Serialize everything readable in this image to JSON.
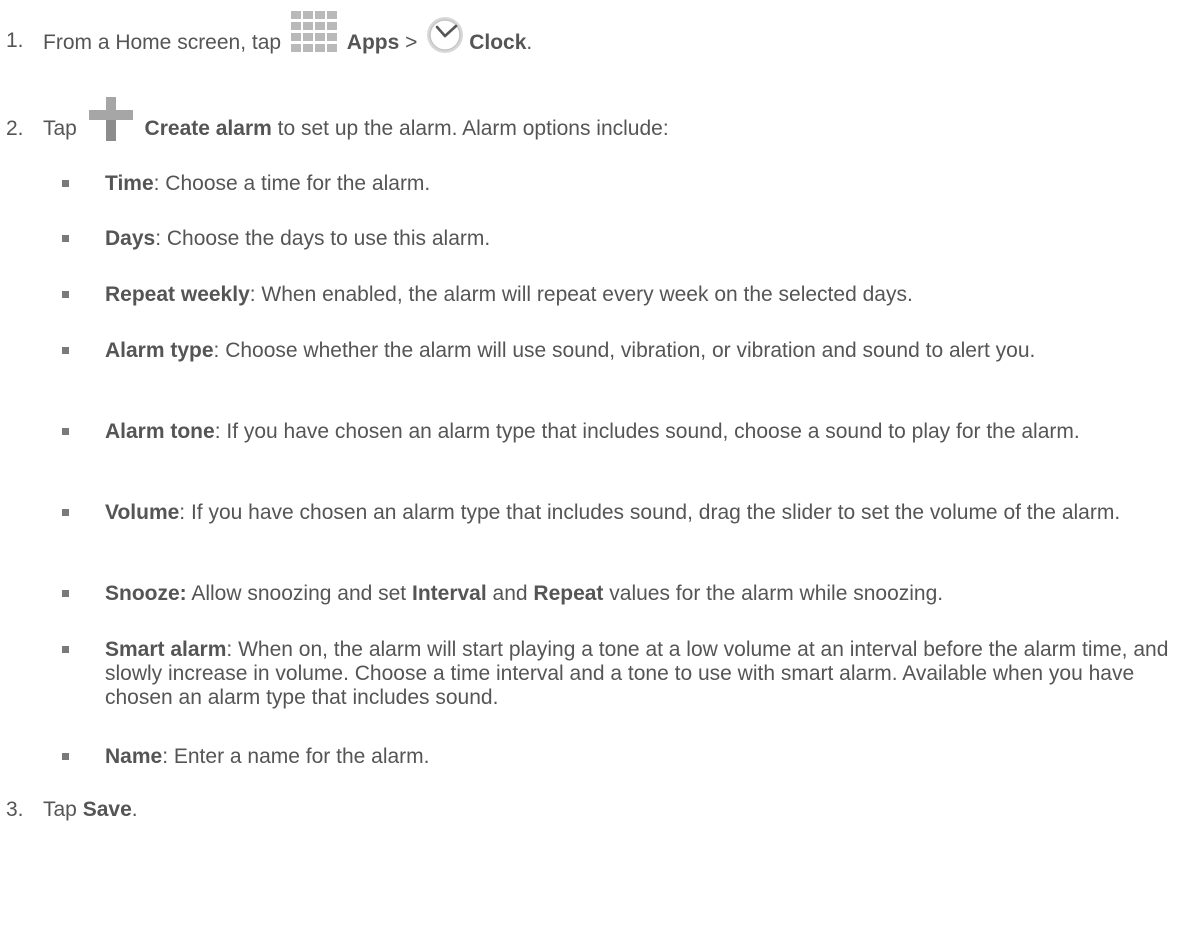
{
  "step1": {
    "num": "1.",
    "pre": "From a Home screen, tap",
    "apps": "Apps",
    "sep": ">",
    "clock": "Clock",
    "end": "."
  },
  "step2": {
    "num": "2.",
    "pre": "Tap",
    "create": "Create alarm",
    "post": "to set up the alarm. Alarm options include:"
  },
  "bullets": [
    {
      "term": "Time",
      "text": ": Choose a time for the alarm."
    },
    {
      "term": "Days",
      "text": ": Choose the days to use this alarm."
    },
    {
      "term": "Repeat weekly",
      "text": ": When enabled, the alarm will repeat every week on the selected days."
    },
    {
      "term": "Alarm type",
      "text": ": Choose whether the alarm will use sound, vibration, or vibration and sound to alert you."
    },
    {
      "term": "Alarm tone",
      "text": ": If you have chosen an alarm type that includes sound, choose a sound to play for the alarm."
    },
    {
      "term": "Volume",
      "text": ": If you have chosen an alarm type that includes sound, drag the slider to set the volume of the alarm."
    },
    {
      "term": "Snooze:",
      "text1": " Allow snoozing and set ",
      "term2": "Interval",
      "text2": " and ",
      "term3": "Repeat",
      "text3": " values for the alarm while snoozing."
    },
    {
      "term": "Smart alarm",
      "text": ": When on, the alarm will start playing a tone at a low volume at an interval before the alarm time, and slowly increase in volume. Choose a time interval and a tone to use with smart alarm. Available when you have chosen an alarm type that includes sound."
    },
    {
      "term": "Name",
      "text": ": Enter a name for the alarm."
    }
  ],
  "step3": {
    "num": "3.",
    "pre": "Tap",
    "save": "Save",
    "end": "."
  }
}
